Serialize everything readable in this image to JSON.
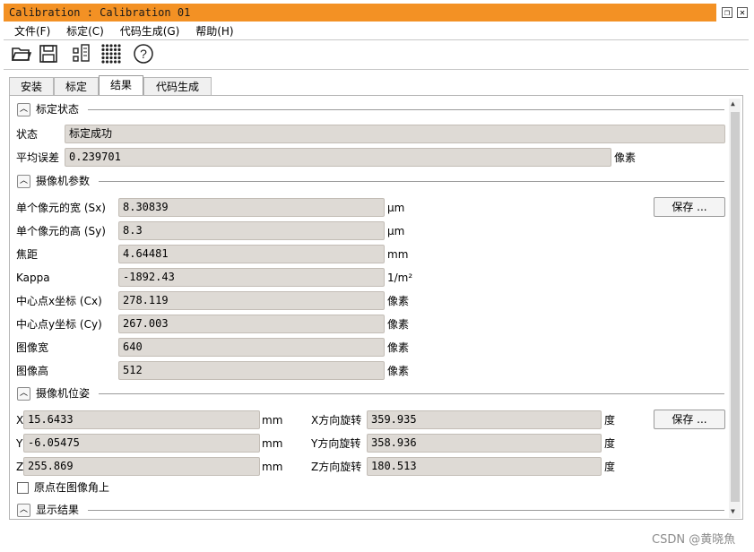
{
  "window": {
    "title": "Calibration : Calibration 01"
  },
  "menu": [
    "文件(F)",
    "标定(C)",
    "代码生成(G)",
    "帮助(H)"
  ],
  "toolbar": [
    "open-icon",
    "save-icon",
    "code-icon",
    "grid-icon",
    "help-icon"
  ],
  "tabs": [
    "安装",
    "标定",
    "结果",
    "代码生成"
  ],
  "status_section": {
    "title": "标定状态",
    "status_label": "状态",
    "status_value": "标定成功",
    "error_label": "平均误差",
    "error_value": "0.239701",
    "error_unit": "像素"
  },
  "camera_params": {
    "title": "摄像机参数",
    "save_label": "保存 ...",
    "rows": [
      {
        "label": "单个像元的宽 (Sx)",
        "value": "8.30839",
        "unit": "μm"
      },
      {
        "label": "单个像元的高 (Sy)",
        "value": "8.3",
        "unit": "μm"
      },
      {
        "label": "焦距",
        "value": "4.64481",
        "unit": "mm"
      },
      {
        "label": "Kappa",
        "value": "-1892.43",
        "unit": "1/m²"
      },
      {
        "label": "中心点x坐标 (Cx)",
        "value": "278.119",
        "unit": "像素"
      },
      {
        "label": "中心点y坐标 (Cy)",
        "value": "267.003",
        "unit": "像素"
      },
      {
        "label": "图像宽",
        "value": "640",
        "unit": "像素"
      },
      {
        "label": "图像高",
        "value": "512",
        "unit": "像素"
      }
    ]
  },
  "pose": {
    "title": "摄像机位姿",
    "save_label": "保存 ...",
    "left": [
      {
        "label": "X",
        "value": "15.6433",
        "unit": "mm"
      },
      {
        "label": "Y",
        "value": "-6.05475",
        "unit": "mm"
      },
      {
        "label": "Z",
        "value": "255.869",
        "unit": "mm"
      }
    ],
    "right": [
      {
        "label": "X方向旋转",
        "value": "359.935",
        "unit": "度"
      },
      {
        "label": "Y方向旋转",
        "value": "358.936",
        "unit": "度"
      },
      {
        "label": "Z方向旋转",
        "value": "180.513",
        "unit": "度"
      }
    ],
    "origin_checkbox": "原点在图像角上",
    "origin_checked": false
  },
  "display": {
    "title": "显示结果"
  },
  "watermark": "CSDN @黄晓魚"
}
